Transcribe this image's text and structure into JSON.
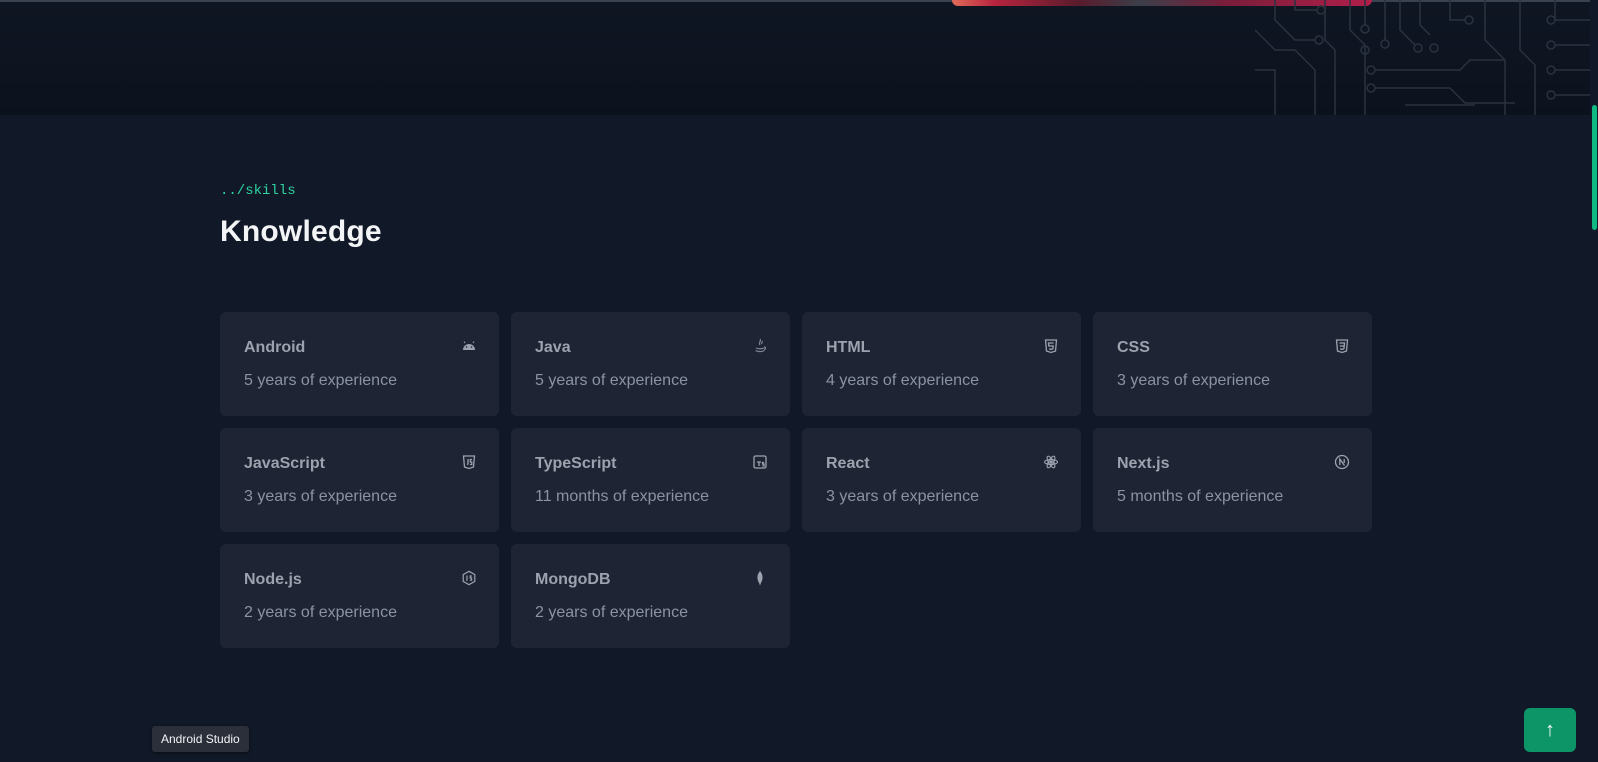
{
  "skills_section": {
    "breadcrumb": "../skills",
    "title": "Knowledge",
    "cards": [
      {
        "name": "Android",
        "experience": "5 years of experience",
        "icon": "android-icon"
      },
      {
        "name": "Java",
        "experience": "5 years of experience",
        "icon": "java-icon"
      },
      {
        "name": "HTML",
        "experience": "4 years of experience",
        "icon": "html5-icon"
      },
      {
        "name": "CSS",
        "experience": "3 years of experience",
        "icon": "css3-icon"
      },
      {
        "name": "JavaScript",
        "experience": "3 years of experience",
        "icon": "javascript-icon"
      },
      {
        "name": "TypeScript",
        "experience": "11 months of experience",
        "icon": "typescript-icon"
      },
      {
        "name": "React",
        "experience": "3 years of experience",
        "icon": "react-icon"
      },
      {
        "name": "Next.js",
        "experience": "5 months of experience",
        "icon": "nextjs-icon"
      },
      {
        "name": "Node.js",
        "experience": "2 years of experience",
        "icon": "nodejs-icon"
      },
      {
        "name": "MongoDB",
        "experience": "2 years of experience",
        "icon": "mongodb-icon"
      }
    ]
  },
  "tooltip": {
    "text": "Android Studio"
  },
  "scroll_top_button": {
    "label": "↑",
    "icon": "arrow-up-icon"
  },
  "colors": {
    "background": "#111827",
    "card": "#1e2433",
    "accent": "#2dd4a0",
    "button": "#0d9568"
  }
}
